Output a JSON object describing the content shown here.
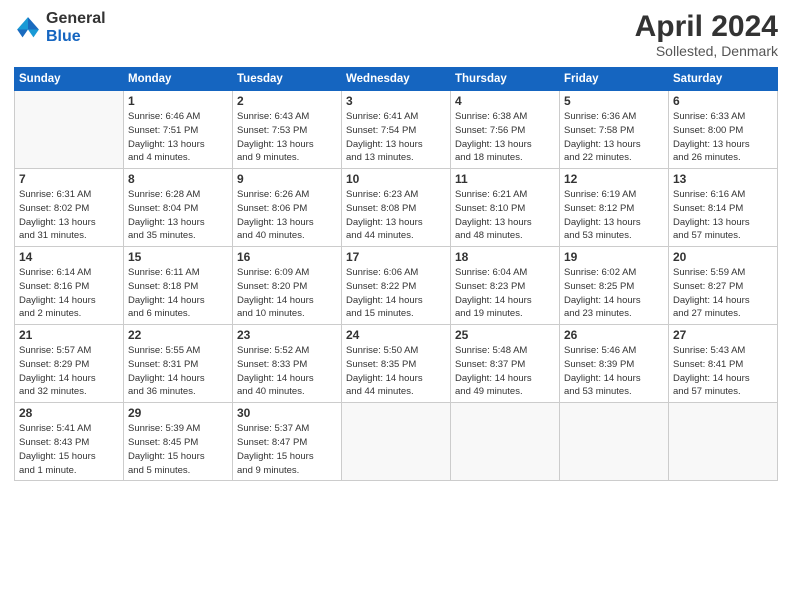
{
  "logo": {
    "general": "General",
    "blue": "Blue"
  },
  "title": "April 2024",
  "subtitle": "Sollested, Denmark",
  "days_header": [
    "Sunday",
    "Monday",
    "Tuesday",
    "Wednesday",
    "Thursday",
    "Friday",
    "Saturday"
  ],
  "weeks": [
    [
      {
        "num": "",
        "detail": ""
      },
      {
        "num": "1",
        "detail": "Sunrise: 6:46 AM\nSunset: 7:51 PM\nDaylight: 13 hours\nand 4 minutes."
      },
      {
        "num": "2",
        "detail": "Sunrise: 6:43 AM\nSunset: 7:53 PM\nDaylight: 13 hours\nand 9 minutes."
      },
      {
        "num": "3",
        "detail": "Sunrise: 6:41 AM\nSunset: 7:54 PM\nDaylight: 13 hours\nand 13 minutes."
      },
      {
        "num": "4",
        "detail": "Sunrise: 6:38 AM\nSunset: 7:56 PM\nDaylight: 13 hours\nand 18 minutes."
      },
      {
        "num": "5",
        "detail": "Sunrise: 6:36 AM\nSunset: 7:58 PM\nDaylight: 13 hours\nand 22 minutes."
      },
      {
        "num": "6",
        "detail": "Sunrise: 6:33 AM\nSunset: 8:00 PM\nDaylight: 13 hours\nand 26 minutes."
      }
    ],
    [
      {
        "num": "7",
        "detail": "Sunrise: 6:31 AM\nSunset: 8:02 PM\nDaylight: 13 hours\nand 31 minutes."
      },
      {
        "num": "8",
        "detail": "Sunrise: 6:28 AM\nSunset: 8:04 PM\nDaylight: 13 hours\nand 35 minutes."
      },
      {
        "num": "9",
        "detail": "Sunrise: 6:26 AM\nSunset: 8:06 PM\nDaylight: 13 hours\nand 40 minutes."
      },
      {
        "num": "10",
        "detail": "Sunrise: 6:23 AM\nSunset: 8:08 PM\nDaylight: 13 hours\nand 44 minutes."
      },
      {
        "num": "11",
        "detail": "Sunrise: 6:21 AM\nSunset: 8:10 PM\nDaylight: 13 hours\nand 48 minutes."
      },
      {
        "num": "12",
        "detail": "Sunrise: 6:19 AM\nSunset: 8:12 PM\nDaylight: 13 hours\nand 53 minutes."
      },
      {
        "num": "13",
        "detail": "Sunrise: 6:16 AM\nSunset: 8:14 PM\nDaylight: 13 hours\nand 57 minutes."
      }
    ],
    [
      {
        "num": "14",
        "detail": "Sunrise: 6:14 AM\nSunset: 8:16 PM\nDaylight: 14 hours\nand 2 minutes."
      },
      {
        "num": "15",
        "detail": "Sunrise: 6:11 AM\nSunset: 8:18 PM\nDaylight: 14 hours\nand 6 minutes."
      },
      {
        "num": "16",
        "detail": "Sunrise: 6:09 AM\nSunset: 8:20 PM\nDaylight: 14 hours\nand 10 minutes."
      },
      {
        "num": "17",
        "detail": "Sunrise: 6:06 AM\nSunset: 8:22 PM\nDaylight: 14 hours\nand 15 minutes."
      },
      {
        "num": "18",
        "detail": "Sunrise: 6:04 AM\nSunset: 8:23 PM\nDaylight: 14 hours\nand 19 minutes."
      },
      {
        "num": "19",
        "detail": "Sunrise: 6:02 AM\nSunset: 8:25 PM\nDaylight: 14 hours\nand 23 minutes."
      },
      {
        "num": "20",
        "detail": "Sunrise: 5:59 AM\nSunset: 8:27 PM\nDaylight: 14 hours\nand 27 minutes."
      }
    ],
    [
      {
        "num": "21",
        "detail": "Sunrise: 5:57 AM\nSunset: 8:29 PM\nDaylight: 14 hours\nand 32 minutes."
      },
      {
        "num": "22",
        "detail": "Sunrise: 5:55 AM\nSunset: 8:31 PM\nDaylight: 14 hours\nand 36 minutes."
      },
      {
        "num": "23",
        "detail": "Sunrise: 5:52 AM\nSunset: 8:33 PM\nDaylight: 14 hours\nand 40 minutes."
      },
      {
        "num": "24",
        "detail": "Sunrise: 5:50 AM\nSunset: 8:35 PM\nDaylight: 14 hours\nand 44 minutes."
      },
      {
        "num": "25",
        "detail": "Sunrise: 5:48 AM\nSunset: 8:37 PM\nDaylight: 14 hours\nand 49 minutes."
      },
      {
        "num": "26",
        "detail": "Sunrise: 5:46 AM\nSunset: 8:39 PM\nDaylight: 14 hours\nand 53 minutes."
      },
      {
        "num": "27",
        "detail": "Sunrise: 5:43 AM\nSunset: 8:41 PM\nDaylight: 14 hours\nand 57 minutes."
      }
    ],
    [
      {
        "num": "28",
        "detail": "Sunrise: 5:41 AM\nSunset: 8:43 PM\nDaylight: 15 hours\nand 1 minute."
      },
      {
        "num": "29",
        "detail": "Sunrise: 5:39 AM\nSunset: 8:45 PM\nDaylight: 15 hours\nand 5 minutes."
      },
      {
        "num": "30",
        "detail": "Sunrise: 5:37 AM\nSunset: 8:47 PM\nDaylight: 15 hours\nand 9 minutes."
      },
      {
        "num": "",
        "detail": ""
      },
      {
        "num": "",
        "detail": ""
      },
      {
        "num": "",
        "detail": ""
      },
      {
        "num": "",
        "detail": ""
      }
    ]
  ]
}
